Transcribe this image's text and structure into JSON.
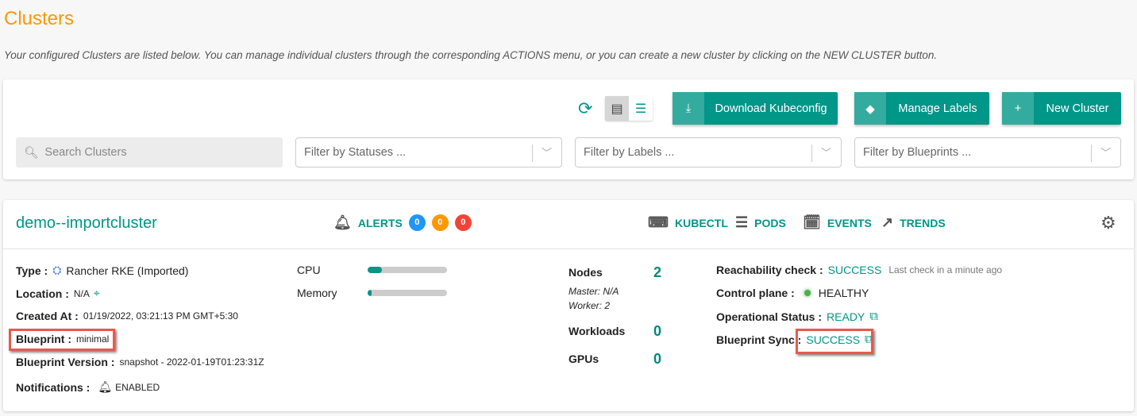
{
  "page": {
    "title": "Clusters",
    "subtitle": "Your configured Clusters are listed below. You can manage individual clusters through the corresponding ACTIONS menu, or you can create a new cluster by clicking on the NEW CLUSTER button."
  },
  "toolbar": {
    "download": "Download Kubeconfig",
    "manage_labels": "Manage Labels",
    "new_cluster": "New Cluster",
    "search_placeholder": "Search Clusters",
    "filter_statuses": "Filter by Statuses ...",
    "filter_labels": "Filter by Labels ...",
    "filter_blueprints": "Filter by Blueprints ..."
  },
  "colors": {
    "title": "#ff9800",
    "accent": "#009688",
    "alert_info": "#2196f3",
    "alert_warning": "#ff9800",
    "alert_critical": "#f44336",
    "healthy": "#4caf50",
    "highlight": "#e8594d"
  },
  "cluster": {
    "name": "demo--importcluster",
    "alerts": {
      "label": "ALERTS",
      "info": "0",
      "warning": "0",
      "critical": "0"
    },
    "actions": [
      "KUBECTL",
      "PODS",
      "EVENTS",
      "TRENDS"
    ],
    "type_label": "Type :",
    "type": "Rancher RKE (Imported)",
    "location_label": "Location :",
    "location": "N/A",
    "created_label": "Created At :",
    "created": "01/19/2022, 03:21:13 PM GMT+5:30",
    "blueprint_label": "Blueprint :",
    "blueprint": "minimal",
    "bp_version_label": "Blueprint Version :",
    "bp_version": "snapshot - 2022-01-19T01:23:31Z",
    "notifications_label": "Notifications :",
    "notifications": "ENABLED",
    "cpu_label": "CPU",
    "cpu_usage_pct": 18,
    "memory_label": "Memory",
    "memory_usage_pct": 3,
    "nodes_label": "Nodes",
    "nodes": "2",
    "master": "Master: N/A",
    "worker": "Worker: 2",
    "workloads_label": "Workloads",
    "workloads": "0",
    "gpus_label": "GPUs",
    "gpus": "0",
    "reach_label": "Reachability check :",
    "reach": "SUCCESS",
    "reach_note": "Last check in a minute ago",
    "cp_label": "Control plane :",
    "cp": "HEALTHY",
    "op_label": "Operational Status :",
    "op": "READY",
    "sync_label": "Blueprint Sync :",
    "sync": "SUCCESS"
  }
}
